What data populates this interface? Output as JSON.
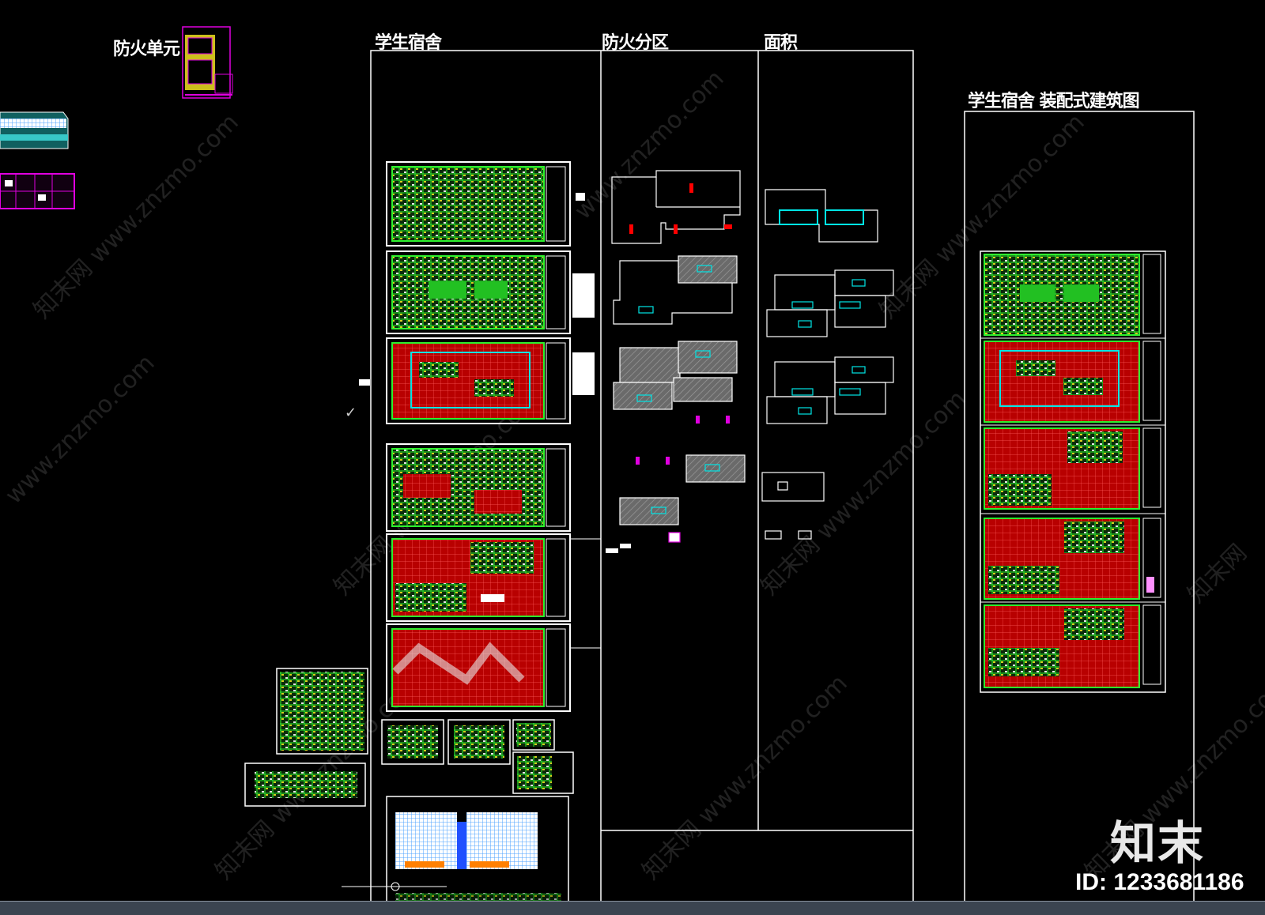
{
  "labels": {
    "fire_unit": "防火单元",
    "dorm": "学生宿舍",
    "fire_zone": "防火分区",
    "area": "面积",
    "dorm_assembly": "学生宿舍 装配式建筑图"
  },
  "watermark": {
    "url": "www.znzmo.com",
    "cn": "知末网"
  },
  "brand": {
    "logo": "知末",
    "id": "ID: 1233681186"
  },
  "colors": {
    "background": "#000000",
    "line_white": "#ffffff",
    "plan_green": "#22e022",
    "plan_red": "#c00000",
    "plan_cyan": "#00e5e5",
    "plan_magenta": "#e000e0",
    "plan_yellow": "#f0e020"
  },
  "icons": {
    "check": "checkmark-icon"
  }
}
